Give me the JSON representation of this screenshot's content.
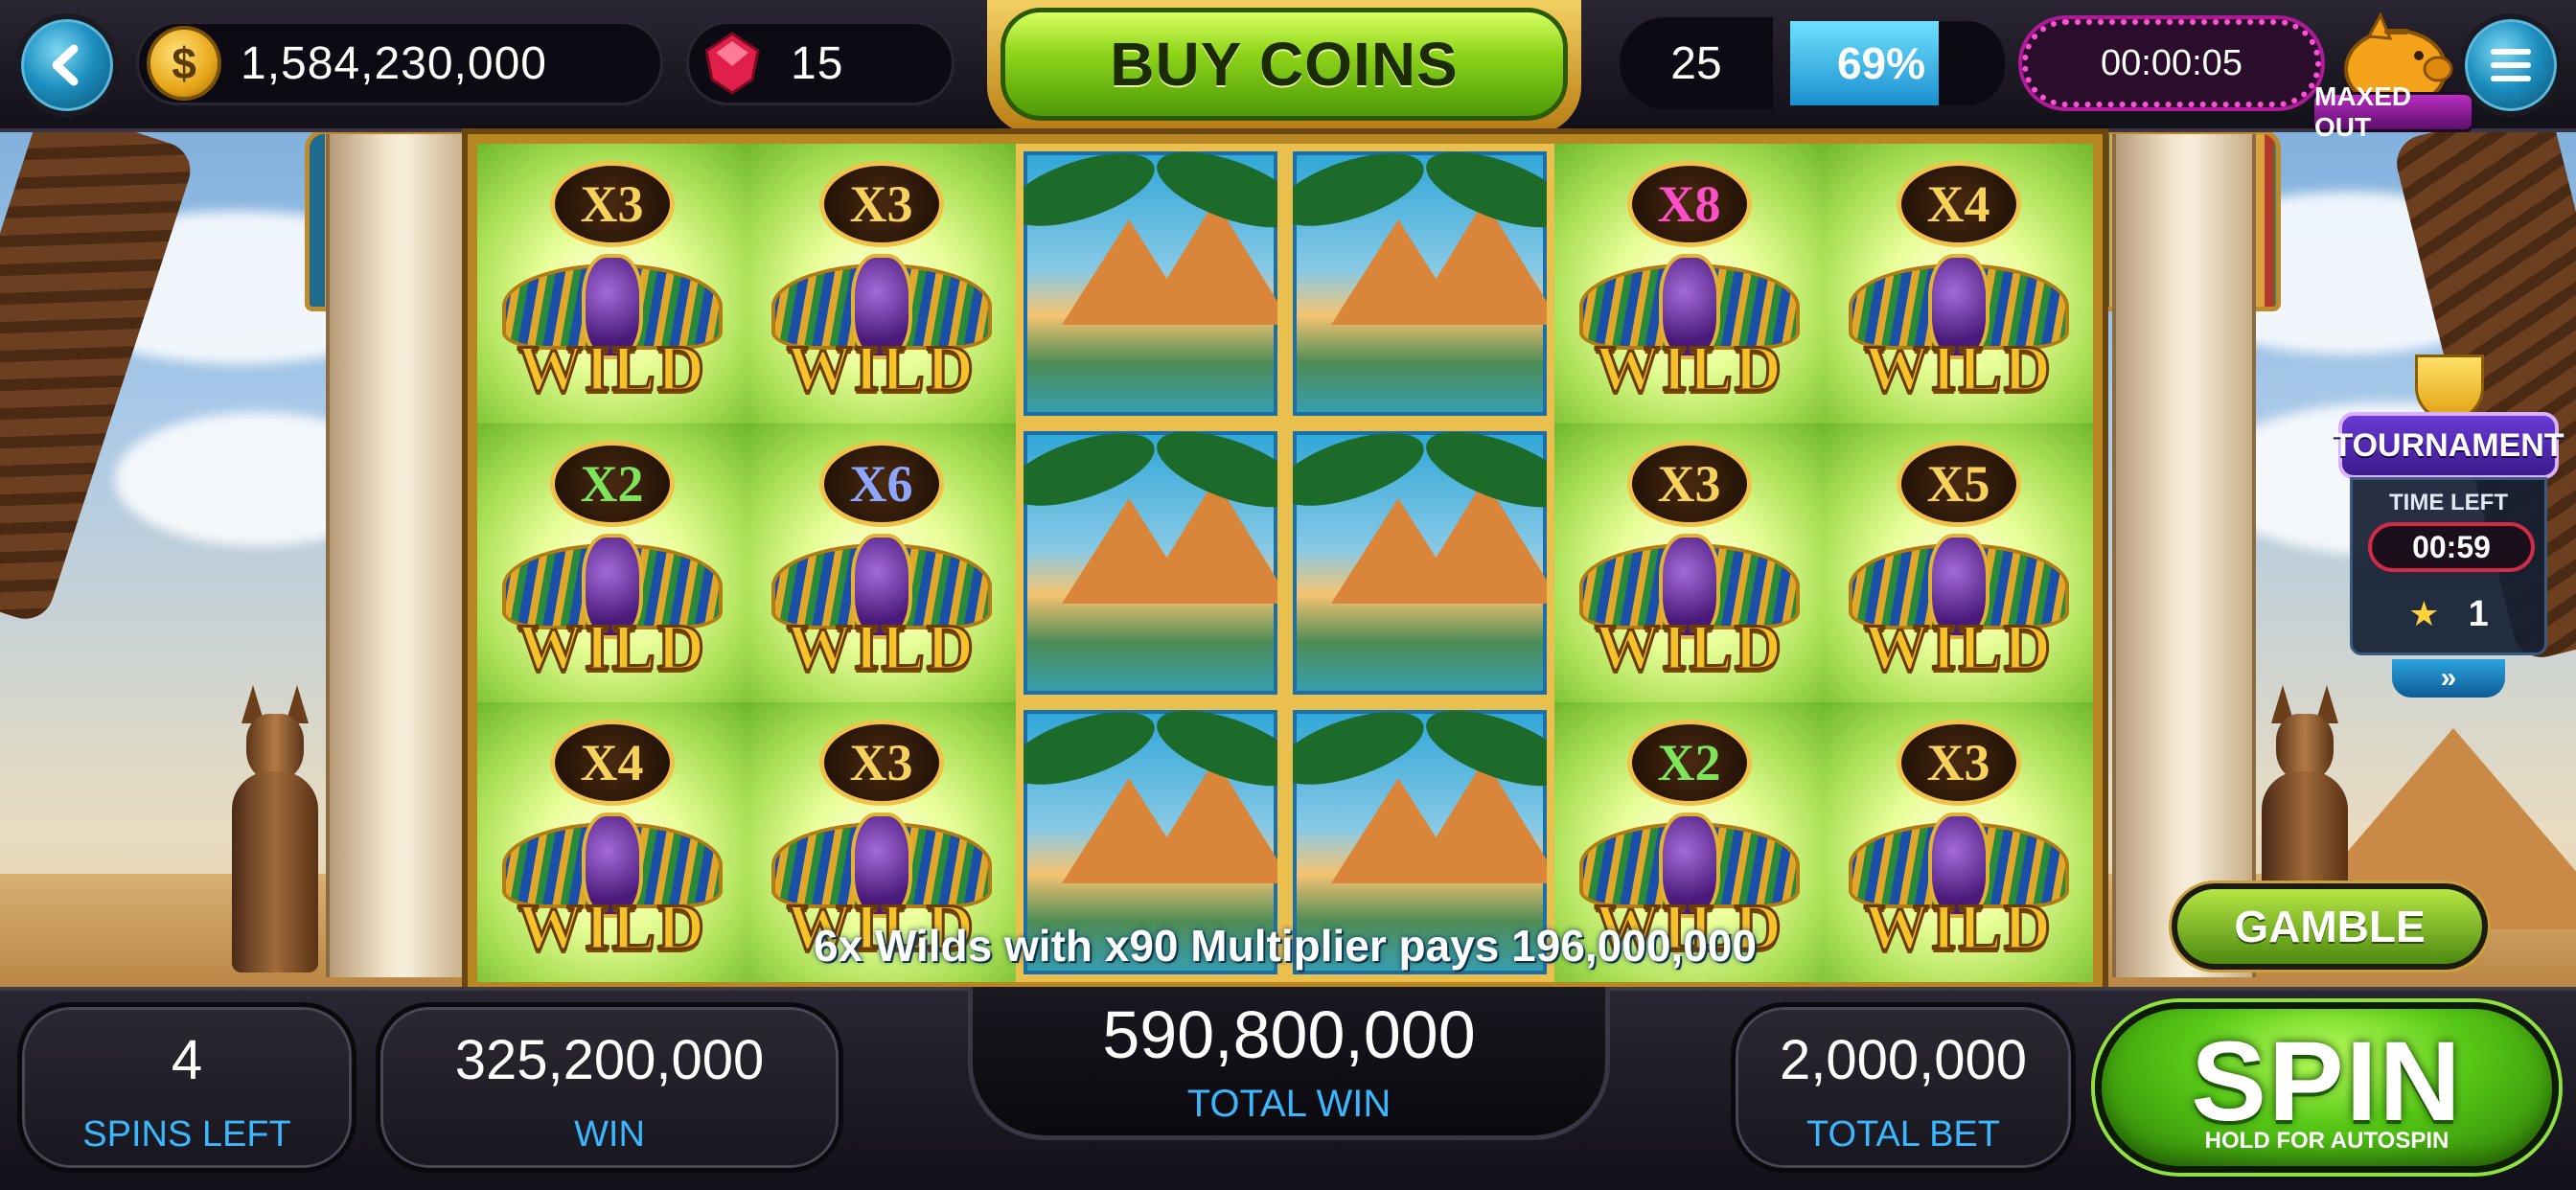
{
  "topbar": {
    "coins": "1,584,230,000",
    "gems": "15",
    "buy_coins_label": "BUY COINS",
    "level": "25",
    "xp_percent_text": "69%",
    "xp_fraction": 0.69,
    "timer": "00:00:05",
    "piggy_status": "MAXED OUT"
  },
  "reels": {
    "grid": [
      [
        {
          "type": "wild",
          "mult": "X3",
          "color": "gold"
        },
        {
          "type": "wild",
          "mult": "X3",
          "color": "gold"
        },
        {
          "type": "scene"
        },
        {
          "type": "scene"
        },
        {
          "type": "wild",
          "mult": "X8",
          "color": "pink"
        },
        {
          "type": "wild",
          "mult": "X4",
          "color": "gold"
        }
      ],
      [
        {
          "type": "wild",
          "mult": "X2",
          "color": "green"
        },
        {
          "type": "wild",
          "mult": "X6",
          "color": "blue"
        },
        {
          "type": "scene"
        },
        {
          "type": "scene"
        },
        {
          "type": "wild",
          "mult": "X3",
          "color": "gold"
        },
        {
          "type": "wild",
          "mult": "X5",
          "color": "gold"
        }
      ],
      [
        {
          "type": "wild",
          "mult": "X4",
          "color": "gold"
        },
        {
          "type": "wild",
          "mult": "X3",
          "color": "gold"
        },
        {
          "type": "scene"
        },
        {
          "type": "scene"
        },
        {
          "type": "wild",
          "mult": "X2",
          "color": "green"
        },
        {
          "type": "wild",
          "mult": "X3",
          "color": "gold"
        }
      ]
    ],
    "wild_word": "WILD",
    "payline_text": "6x Wilds with x90 Multiplier pays 196,000,000"
  },
  "gamble_label": "GAMBLE",
  "tournament": {
    "title": "TOURNAMENT",
    "time_left_label": "TIME LEFT",
    "time_left": "00:59",
    "rank": "1",
    "more": "»"
  },
  "bottom": {
    "spins_left": "4",
    "spins_left_label": "SPINS LEFT",
    "win": "325,200,000",
    "win_label": "WIN",
    "total_win": "590,800,000",
    "total_win_label": "TOTAL WIN",
    "total_bet": "2,000,000",
    "total_bet_label": "TOTAL BET",
    "spin_label": "SPIN",
    "spin_sub": "HOLD FOR AUTOSPIN"
  },
  "colors": {
    "accent_blue": "#3ab8ff",
    "spin_green": "#56c716",
    "buy_green": "#8ed41a",
    "timer_pink": "#ff4fd6",
    "mult_gold": "#f7d25b",
    "mult_green": "#7ee55a",
    "mult_blue": "#8ea6ff",
    "mult_pink": "#ff4fc8"
  },
  "icons": {
    "back": "back-arrow-icon",
    "coin": "coin-icon",
    "gem": "ruby-gem-icon",
    "piggy": "piggy-bank-icon",
    "menu": "hamburger-menu-icon",
    "star": "star-icon",
    "trophy": "trophy-icon"
  }
}
